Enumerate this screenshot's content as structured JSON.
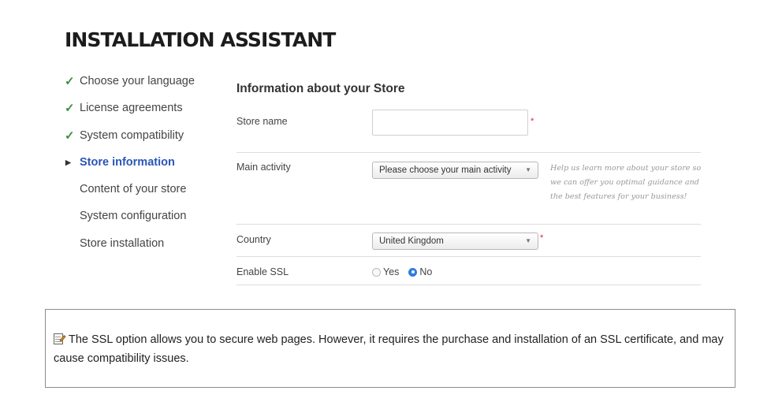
{
  "page_title": "INSTALLATION ASSISTANT",
  "steps": [
    {
      "label": "Choose your language",
      "state": "done"
    },
    {
      "label": "License agreements",
      "state": "done"
    },
    {
      "label": "System compatibility",
      "state": "done"
    },
    {
      "label": "Store information",
      "state": "current"
    },
    {
      "label": "Content of your store",
      "state": "pending"
    },
    {
      "label": "System configuration",
      "state": "pending"
    },
    {
      "label": "Store installation",
      "state": "pending"
    }
  ],
  "form": {
    "title": "Information about your Store",
    "store_name": {
      "label": "Store name",
      "value": "",
      "required_mark": "*"
    },
    "main_activity": {
      "label": "Main activity",
      "selected": "Please choose your main activity",
      "help": "Help us learn more about your store so we can offer you optimal guidance and the best features for your business!"
    },
    "country": {
      "label": "Country",
      "selected": "United Kingdom",
      "required_mark": "*"
    },
    "ssl": {
      "label": "Enable SSL",
      "options": [
        "Yes",
        "No"
      ],
      "selected": "No"
    }
  },
  "note": {
    "icon": "memo-icon",
    "text": "The SSL option allows you to secure web pages. However, it requires the purchase and installation of an SSL certificate, and may cause compatibility issues."
  },
  "colors": {
    "active_step": "#2a55b8",
    "check": "#3e8f3e",
    "required": "#dd2233",
    "radio_selected": "#2f7be0"
  }
}
